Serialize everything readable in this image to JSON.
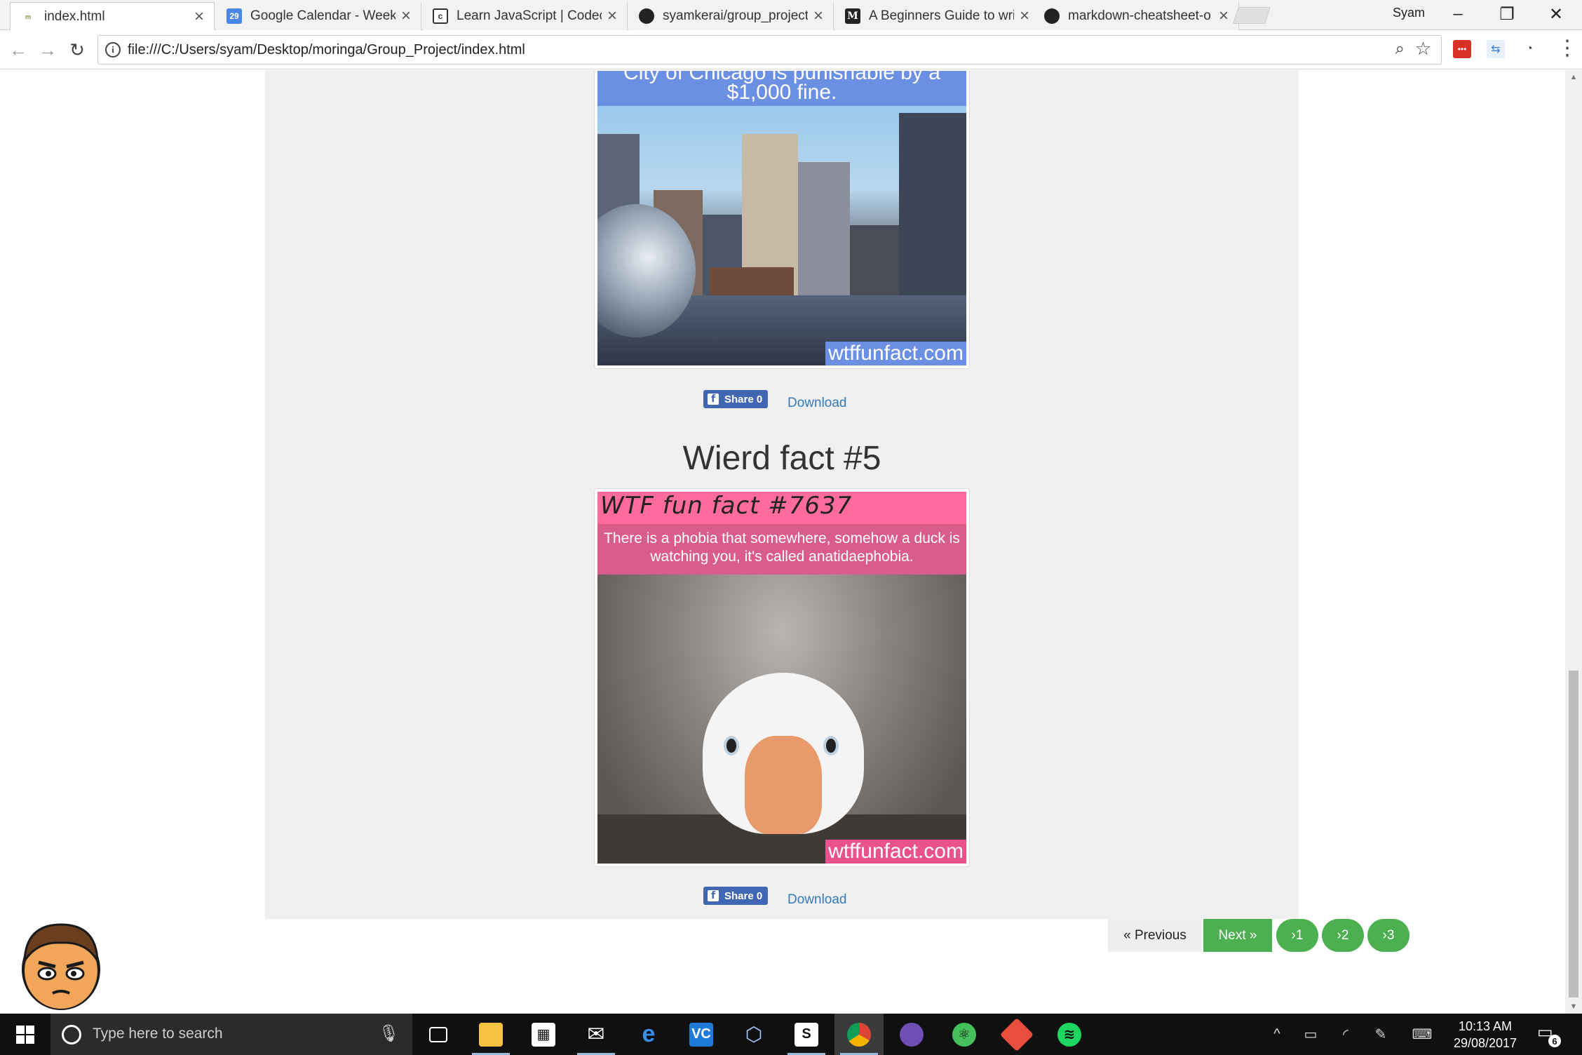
{
  "browser": {
    "profile_name": "Syam",
    "tabs": [
      {
        "title": "index.html",
        "favicon": "moringa-icon",
        "active": true
      },
      {
        "title": "Google Calendar - Week",
        "favicon": "calendar-icon",
        "badge": "29"
      },
      {
        "title": "Learn JavaScript | Codeca",
        "favicon": "codecademy-icon"
      },
      {
        "title": "syamkerai/group_project",
        "favicon": "github-icon"
      },
      {
        "title": "A Beginners Guide to wri",
        "favicon": "medium-icon"
      },
      {
        "title": "markdown-cheatsheet-o",
        "favicon": "github-icon"
      }
    ],
    "url": "file:///C:/Users/syam/Desktop/moringa/Group_Project/index.html"
  },
  "page": {
    "fact4": {
      "image_caption_line1": "City of Chicago is punishable by a",
      "image_caption_line2": "$1,000 fine.",
      "watermark": "wtffunfact.com",
      "share_label": "Share 0",
      "download_label": "Download"
    },
    "fact5": {
      "heading": "Wierd fact #5",
      "image_title": "WTF fun fact #7637",
      "image_text": "There is a phobia that somewhere, somehow a duck is watching you, it's called anatidaephobia.",
      "watermark": "wtffunfact.com",
      "share_label": "Share 0",
      "download_label": "Download"
    },
    "pagination": {
      "previous": "« Previous",
      "next": "Next »",
      "pages": [
        "›1",
        "›2",
        "›3"
      ]
    }
  },
  "taskbar": {
    "search_placeholder": "Type here to search",
    "time": "10:13 AM",
    "date": "29/08/2017",
    "notification_count": "6"
  }
}
